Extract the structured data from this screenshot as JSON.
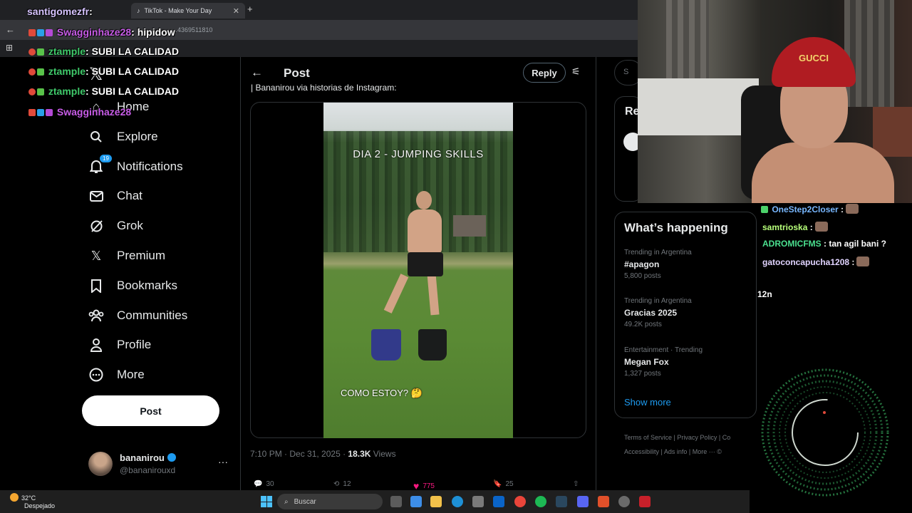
{
  "browser": {
    "tab_title": "TikTok - Make Your Day",
    "url": "…4369511810"
  },
  "nav": {
    "home": "Home",
    "explore": "Explore",
    "notifications": "Notifications",
    "notifications_badge": "19",
    "chat": "Chat",
    "grok": "Grok",
    "premium": "Premium",
    "bookmarks": "Bookmarks",
    "communities": "Communities",
    "profile": "Profile",
    "more": "More",
    "post_button": "Post"
  },
  "account": {
    "name": "bananirou",
    "handle": "@bananirouxd"
  },
  "post": {
    "header": "Post",
    "reply": "Reply",
    "caption": "| Bananirou via historias de Instagram:",
    "video_text_top": "DIA 2 - JUMPING SKILLS",
    "video_text_bottom": "COMO ESTOY? 🤔",
    "time": "7:10 PM · Dec 31, 2025 · ",
    "views_count": "18.3K",
    "views_label": " Views",
    "replies": "30",
    "reposts": "12",
    "likes": "775",
    "bookmarks": "25"
  },
  "sidebar": {
    "search_placeholder": "S",
    "relevant_title": "Re",
    "happening_title": "What’s happening",
    "trends": [
      {
        "context": "Trending in Argentina",
        "name": "#apagon",
        "count": "5,800 posts"
      },
      {
        "context": "Trending in Argentina",
        "name": "Gracias 2025",
        "count": "49.2K posts"
      },
      {
        "context": "Entertainment · Trending",
        "name": "Megan Fox",
        "count": "1,327 posts"
      }
    ],
    "show_more": "Show more",
    "footer_line1": "Terms of Service  |  Privacy Policy  |  Co",
    "footer_line2": "Accessibility  |  Ads info  |  More ···  ©"
  },
  "chat_overlay": [
    {
      "user": "santigomezfr",
      "msg": ":"
    },
    {
      "user": "Swagginhaze28",
      "msg": ": hipidow"
    },
    {
      "user": "ztample",
      "msg": ": SUBI LA CALIDAD"
    },
    {
      "user": "ztample",
      "msg": ": SUBI LA CALIDAD"
    },
    {
      "user": "ztample",
      "msg": ": SUBI LA CALIDAD"
    },
    {
      "user": "Swagginhaze28",
      "msg": ""
    }
  ],
  "chat_right": [
    {
      "user": "OneStep2Closer",
      "msg": " :"
    },
    {
      "user": "samtrioska",
      "msg": " :"
    },
    {
      "user": "ADROMICFMS",
      "msg": " : tan agil bani ?"
    },
    {
      "user": "gatoconcapucha1208",
      "msg": " :"
    }
  ],
  "chat_right_extra": "12n",
  "webcam": {
    "cap_text": "GUCCI"
  },
  "taskbar": {
    "temp": "32°C",
    "weather": "Despejado",
    "search": "Buscar"
  }
}
